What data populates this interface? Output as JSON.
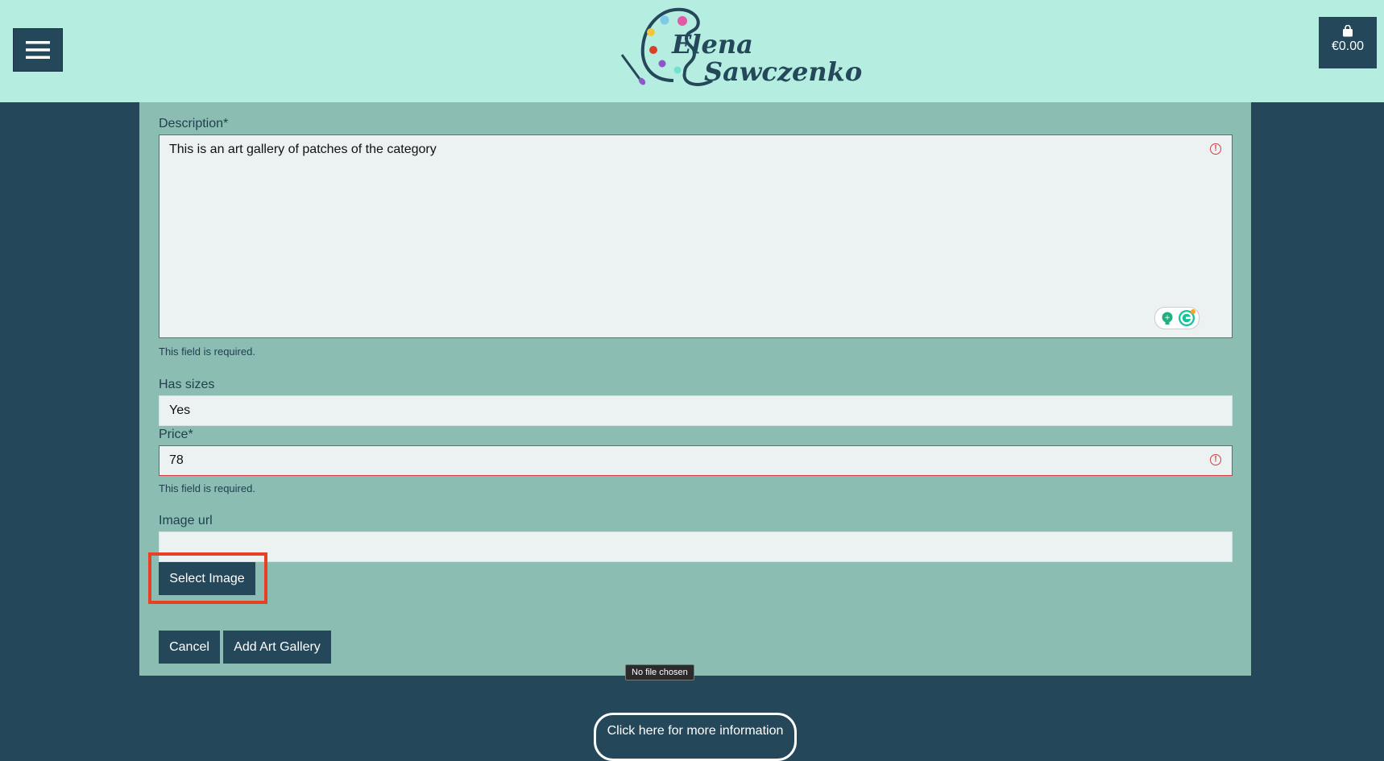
{
  "header": {
    "brand_first": "Elena",
    "brand_last": "Sawczenko",
    "cart_total": "€0.00",
    "menu_icon": "hamburger-icon",
    "cart_icon": "shopping-bag-icon"
  },
  "form": {
    "description": {
      "label": "Description*",
      "value": "This is an art gallery of patches of the category",
      "help": "This field is required."
    },
    "has_sizes": {
      "label": "Has sizes",
      "value": "Yes"
    },
    "price": {
      "label": "Price*",
      "value": "78",
      "help": "This field is required."
    },
    "image_url": {
      "label": "Image url",
      "value": ""
    },
    "select_image_label": "Select Image",
    "file_status": "No file chosen",
    "cancel_label": "Cancel",
    "submit_label": "Add Art Gallery"
  },
  "footer": {
    "info_label": "Click here for more information"
  },
  "colors": {
    "header_bg": "#b5eee0",
    "page_bg": "#25475a",
    "panel_bg": "#8cbdb2",
    "error": "#d33b46",
    "highlight": "#e84024"
  }
}
